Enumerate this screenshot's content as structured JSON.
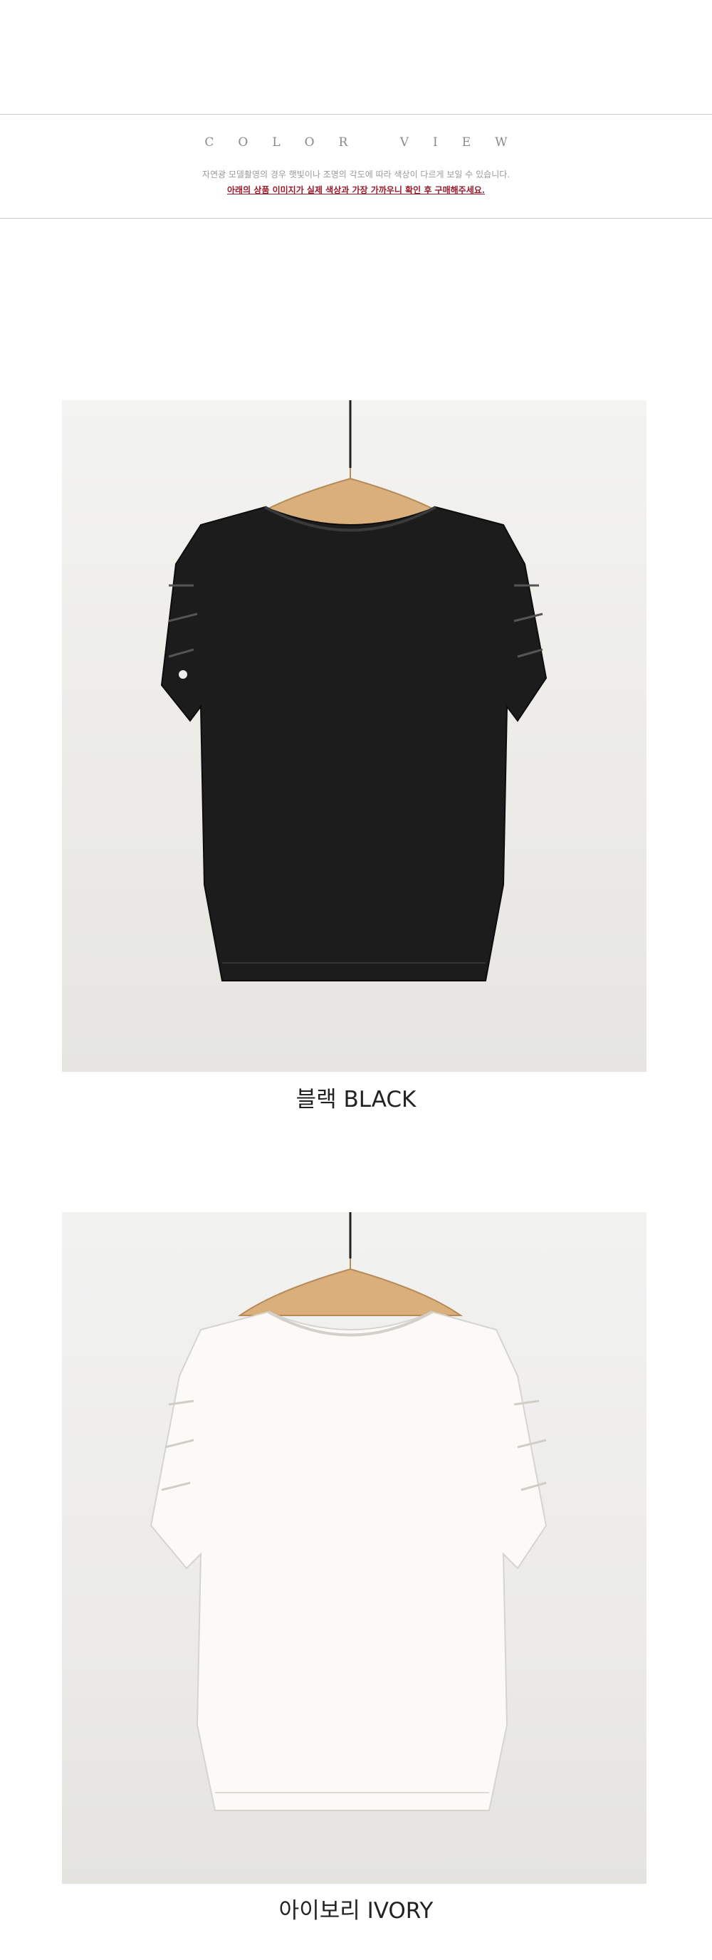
{
  "header": {
    "title": "COLOR VIEW",
    "notice_line1": "자연광 모델촬영의 경우 햇빛이나 조명의 각도에 따라 색상이 다르게 보일 수 있습니다.",
    "notice_line2": "아래의 상품 이미지가 실제 색상과 가장 가까우니 확인 후 구매해주세요."
  },
  "colors": [
    {
      "name": "블랙 BLACK",
      "swatch": "#1c1c1c"
    },
    {
      "name": "아이보리 IVORY",
      "swatch": "#fbfaf6"
    }
  ]
}
